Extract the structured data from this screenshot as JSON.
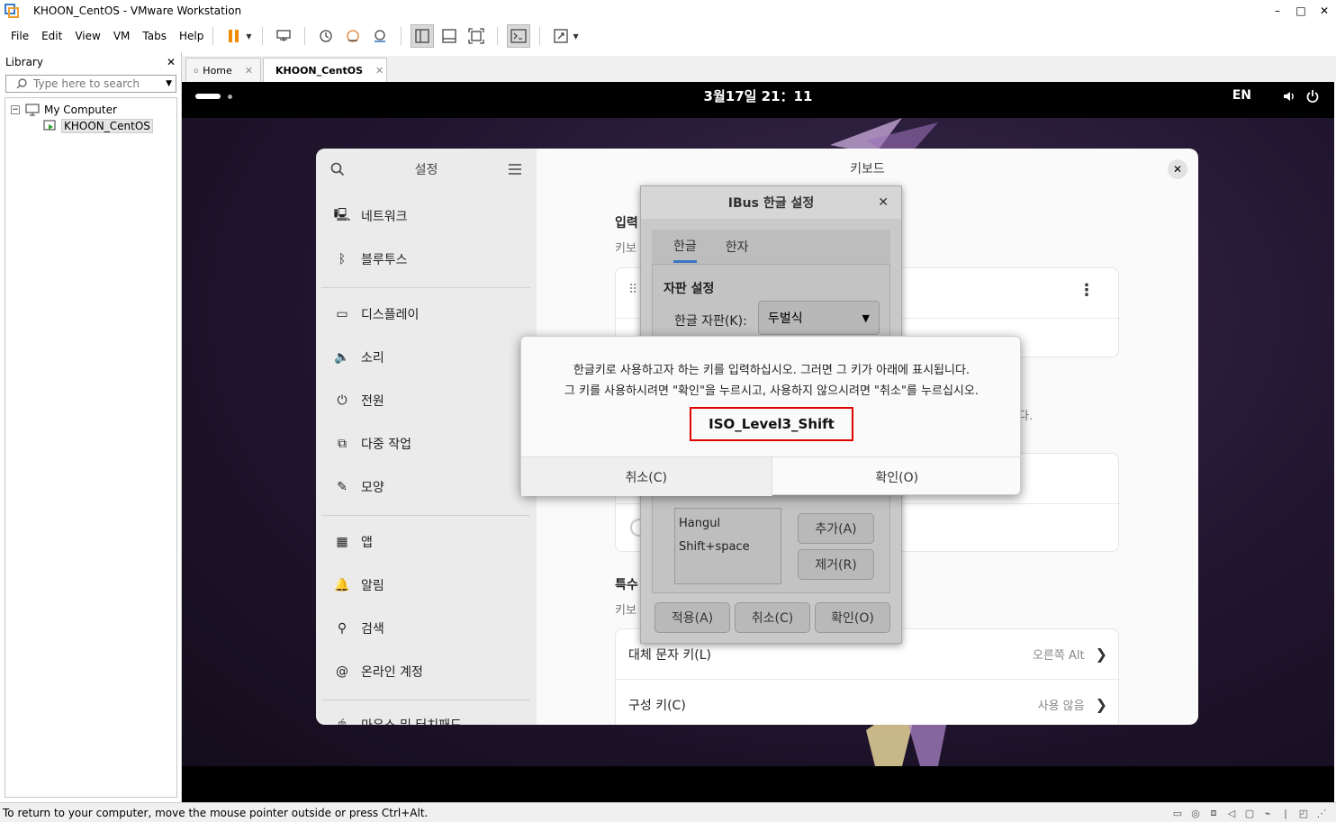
{
  "window": {
    "title": "KHOON_CentOS - VMware Workstation",
    "controls": [
      "–",
      "□",
      "✕"
    ]
  },
  "menu": [
    {
      "label": "File",
      "key": "F"
    },
    {
      "label": "Edit",
      "key": "E"
    },
    {
      "label": "View",
      "key": "V"
    },
    {
      "label": "VM",
      "key": "M"
    },
    {
      "label": "Tabs",
      "key": "T"
    },
    {
      "label": "Help",
      "key": "H"
    }
  ],
  "library": {
    "title": "Library",
    "search_placeholder": "Type here to search",
    "tree": {
      "root": "My Computer",
      "child": "KHOON_CentOS"
    }
  },
  "tabs": [
    {
      "label": "Home",
      "active": false
    },
    {
      "label": "KHOON_CentOS",
      "active": true
    }
  ],
  "guest": {
    "clock": "3월17일 21：11",
    "lang": "EN",
    "settings": {
      "sidebar_title": "설정",
      "title": "키보드",
      "sidebar_items": [
        {
          "label": "네트워크",
          "icon": "network-icon"
        },
        {
          "label": "블루투스",
          "icon": "bluetooth-icon"
        },
        {
          "label": "디스플레이",
          "icon": "display-icon"
        },
        {
          "label": "소리",
          "icon": "sound-icon"
        },
        {
          "label": "전원",
          "icon": "power-icon"
        },
        {
          "label": "다중 작업",
          "icon": "multitasking-icon"
        },
        {
          "label": "모양",
          "icon": "appearance-icon"
        },
        {
          "label": "앱",
          "icon": "apps-icon"
        },
        {
          "label": "알림",
          "icon": "bell-icon"
        },
        {
          "label": "검색",
          "icon": "search-icon"
        },
        {
          "label": "온라인 계정",
          "icon": "at-icon"
        },
        {
          "label": "마우스 및 터치패드",
          "icon": "mouse-icon"
        }
      ],
      "section_input": "입력",
      "section_input_sub": "키보",
      "section_special": "특수",
      "section_special_sub": "키보",
      "partial_text_a": "다.",
      "rows": [
        {
          "label": "대체 문자 키(L)",
          "value": "오른쪽 Alt"
        },
        {
          "label": "구성 키(C)",
          "value": "사용 않음"
        }
      ]
    },
    "ibus": {
      "title": "IBus 한글 설정",
      "tabs": [
        "한글",
        "한자"
      ],
      "section": "자판 설정",
      "layout_label": "한글 자판(K):",
      "layout_value": "두벌식",
      "hangul_keys": [
        "Hangul",
        "Shift+space"
      ],
      "add_label": "추가(A)",
      "remove_label": "제거(R)",
      "apply_label": "적용(A)",
      "cancel_label": "취소(C)",
      "ok_label": "확인(O)"
    },
    "keydialog": {
      "line1": "한글키로 사용하고자 하는 키를 입력하십시오. 그러면 그 키가 아래에 표시됩니다.",
      "line2": "그 키를 사용하시려면 \"확인\"을 누르시고, 사용하지 않으시려면 \"취소\"를 누르십시오.",
      "key": "ISO_Level3_Shift",
      "cancel_label": "취소(C)",
      "ok_label": "확인(O)"
    }
  },
  "statusbar": {
    "message": "To return to your computer, move the mouse pointer outside or press Ctrl+Alt."
  }
}
